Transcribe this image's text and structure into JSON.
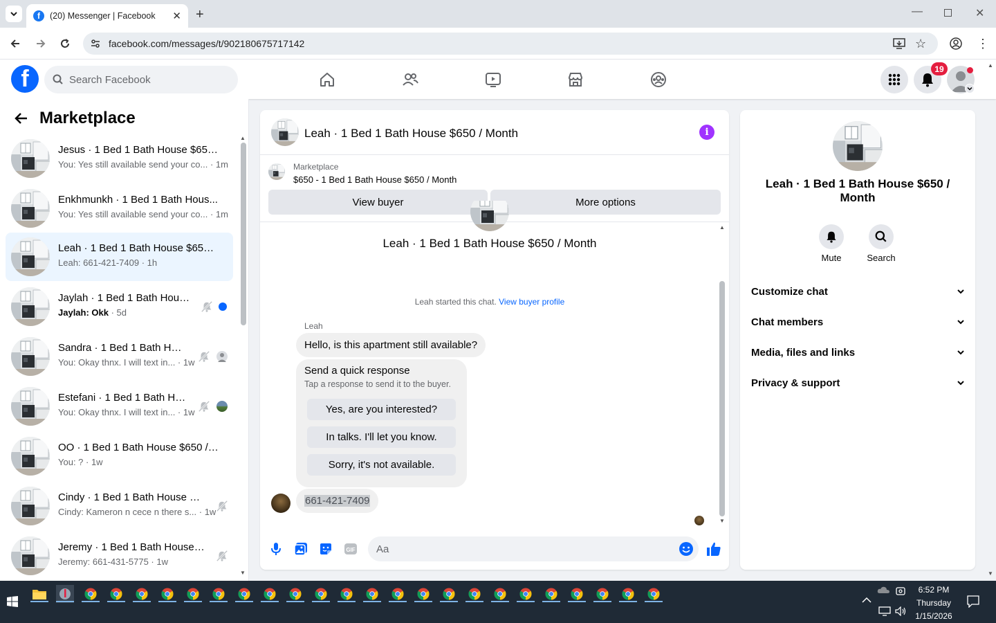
{
  "browser": {
    "tab_title": "(20) Messenger | Facebook",
    "url": "facebook.com/messages/t/902180675717142"
  },
  "fb_header": {
    "search_placeholder": "Search Facebook",
    "notification_count": "19"
  },
  "sidebar": {
    "title": "Marketplace",
    "conversations": [
      {
        "name": "Jesus · 1 Bed 1 Bath House $650 ...",
        "preview": "You: Yes still available send your co... · 1m",
        "muted": false,
        "unread": false
      },
      {
        "name": "Enkhmunkh · 1 Bed 1 Bath Hous...",
        "preview": "You: Yes still available send your co... · 1m",
        "muted": false,
        "unread": false
      },
      {
        "name": "Leah · 1 Bed 1 Bath House $650 /...",
        "preview": "Leah: 661-421-7409 · 1h",
        "muted": false,
        "unread": false,
        "active": true
      },
      {
        "name": "Jaylah · 1 Bed 1 Bath House...",
        "preview_sender": "Jaylah: Okk",
        "preview_time": " · 5d",
        "muted": true,
        "unread": true
      },
      {
        "name": "Sandra · 1 Bed 1 Bath Hou...",
        "preview": "You: Okay thnx. I will text in... · 1w",
        "muted": true
      },
      {
        "name": "Estefani · 1 Bed 1 Bath Ho...",
        "preview": "You: Okay thnx. I will text in... · 1w",
        "muted": true
      },
      {
        "name": "OO · 1 Bed 1 Bath House $650 / ...",
        "preview": "You: ? · 1w",
        "muted": false
      },
      {
        "name": "Cindy · 1 Bed 1 Bath House $6...",
        "preview": "Cindy: Kameron n cece n there s... · 1w",
        "muted": true
      },
      {
        "name": "Jeremy · 1 Bed 1 Bath House $...",
        "preview": "Jeremy: 661-431-5775 · 1w",
        "muted": true
      }
    ]
  },
  "chat": {
    "title": "Leah · 1 Bed 1 Bath House $650 / Month",
    "marketplace_label": "Marketplace",
    "listing": "$650 - 1 Bed 1 Bath House $650 / Month",
    "view_buyer": "View buyer",
    "more_options": "More options",
    "conversation_title": "Leah · 1 Bed 1 Bath House $650 / Month",
    "started_text": "Leah started this chat. ",
    "view_buyer_profile": "View buyer profile",
    "sender_name": "Leah",
    "message1": "Hello, is this apartment still available?",
    "quick_title": "Send a quick response",
    "quick_subtitle": "Tap a response to send it to the buyer.",
    "quick_responses": [
      "Yes, are you interested?",
      "In talks. I'll let you know.",
      "Sorry, it's not available."
    ],
    "message2": "661-421-7409",
    "composer_placeholder": "Aa"
  },
  "right_panel": {
    "name": "Leah · 1 Bed 1 Bath House $650 / Month",
    "mute_label": "Mute",
    "search_label": "Search",
    "sections": [
      "Customize chat",
      "Chat members",
      "Media, files and links",
      "Privacy & support"
    ]
  },
  "taskbar": {
    "time": "6:52 PM",
    "day": "Thursday",
    "date": "1/15/2026"
  },
  "colors": {
    "fb_blue": "#0866ff",
    "active_convo_bg": "#ebf5ff",
    "badge_red": "#e41e3f",
    "info_purple": "#a033ff"
  }
}
